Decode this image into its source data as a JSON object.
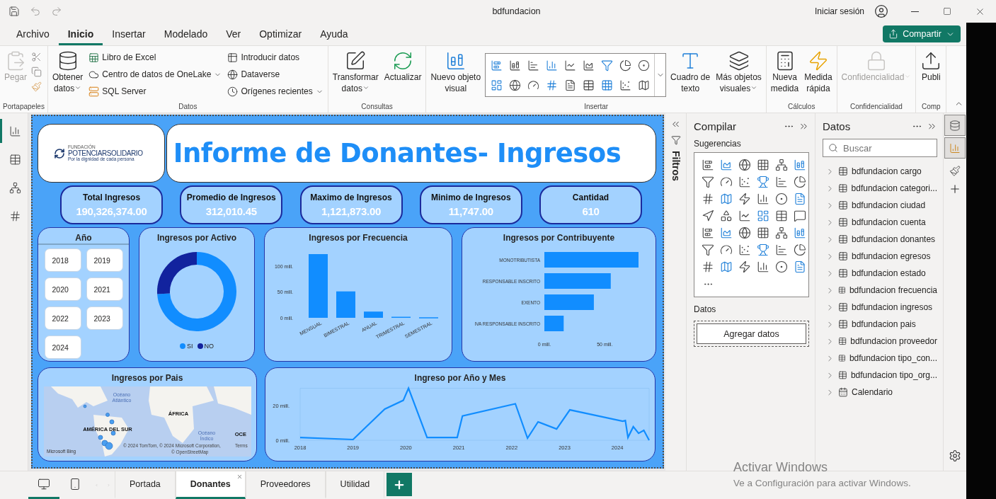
{
  "window": {
    "title": "bdfundacion",
    "sign_in": "Iniciar sesión"
  },
  "menu": [
    {
      "label": "Archivo",
      "selected": false
    },
    {
      "label": "Inicio",
      "selected": true
    },
    {
      "label": "Insertar",
      "selected": false
    },
    {
      "label": "Modelado",
      "selected": false
    },
    {
      "label": "Ver",
      "selected": false
    },
    {
      "label": "Optimizar",
      "selected": false
    },
    {
      "label": "Ayuda",
      "selected": false
    }
  ],
  "share_button": {
    "label": "Compartir"
  },
  "ribbon": [
    {
      "name": "Portapapeles",
      "items": [
        {
          "kind": "large",
          "lines": [
            "Pegar"
          ],
          "caret": false,
          "disabled": true
        },
        {
          "kind": "tools"
        }
      ]
    },
    {
      "name": "Datos",
      "items": [
        {
          "kind": "large",
          "lines": [
            "Obtener",
            "datos"
          ],
          "caret": true,
          "disabled": false
        },
        {
          "kind": "stack",
          "entries": [
            {
              "label": "Libro de Excel",
              "caret": false
            },
            {
              "label": "Centro de datos de OneLake",
              "caret": true
            },
            {
              "label": "SQL Server",
              "caret": false
            }
          ]
        },
        {
          "kind": "stack",
          "entries": [
            {
              "label": "Introducir datos",
              "caret": false
            },
            {
              "label": "Dataverse",
              "caret": false
            },
            {
              "label": "Orígenes recientes",
              "caret": true
            }
          ]
        }
      ]
    },
    {
      "name": "Consultas",
      "items": [
        {
          "kind": "large",
          "lines": [
            "Transformar",
            "datos"
          ],
          "caret": true,
          "disabled": false
        },
        {
          "kind": "large",
          "lines": [
            "Actualizar"
          ],
          "caret": false,
          "disabled": false
        }
      ]
    },
    {
      "name": "Insertar",
      "items": [
        {
          "kind": "large",
          "lines": [
            "Nuevo objeto",
            "visual"
          ],
          "caret": false,
          "disabled": false
        },
        {
          "kind": "gallery"
        },
        {
          "kind": "large",
          "lines": [
            "Cuadro de",
            "texto"
          ],
          "caret": false,
          "disabled": false
        },
        {
          "kind": "large",
          "lines": [
            "Más objetos",
            "visuales"
          ],
          "caret": true,
          "disabled": false
        }
      ]
    },
    {
      "name": "Cálculos",
      "items": [
        {
          "kind": "large",
          "lines": [
            "Nueva",
            "medida"
          ],
          "caret": false,
          "disabled": false
        },
        {
          "kind": "large",
          "lines": [
            "Medida",
            "rápida"
          ],
          "caret": false,
          "disabled": false
        }
      ]
    },
    {
      "name": "Confidencialidad",
      "items": [
        {
          "kind": "large",
          "lines": [
            "Confidencialidad"
          ],
          "caret": true,
          "disabled": true
        }
      ]
    },
    {
      "name": "Comp",
      "items": [
        {
          "kind": "large",
          "lines": [
            "Publi"
          ],
          "caret": false,
          "disabled": false
        }
      ]
    }
  ],
  "view_nav": [
    {
      "selected": true
    },
    {
      "selected": false
    },
    {
      "selected": false
    },
    {
      "selected": false
    }
  ],
  "report": {
    "logo": {
      "overline": "FUNDACIÓN",
      "name": "POTENCIARSOLIDARIO",
      "tagline": "Por la dignidad de cada persona"
    },
    "title": "Informe de Donantes- Ingresos",
    "kpis": [
      {
        "label": "Total Ingresos",
        "value": "190,326,374.00"
      },
      {
        "label": "Promedio de Ingresos",
        "value": "312,010.45"
      },
      {
        "label": "Maximo de Ingresos",
        "value": "1,121,873.00"
      },
      {
        "label": "Minimo de Ingresos",
        "value": "11,747.00"
      },
      {
        "label": "Cantidad",
        "value": "610"
      }
    ],
    "year_slicer": {
      "title": "Año",
      "years": [
        "2018",
        "2019",
        "2020",
        "2021",
        "2022",
        "2023",
        "2024"
      ]
    },
    "activo": {
      "title": "Ingresos por Activo",
      "legend": [
        {
          "color": "#118dff"
        },
        {
          "color": "#12239e"
        }
      ],
      "chart_data": {
        "type": "donut",
        "categories": [
          "SI",
          "NO"
        ],
        "values": [
          74,
          26
        ]
      }
    },
    "frecuencia": {
      "title": "Ingresos por Frecuencia",
      "chart_data": {
        "type": "bar",
        "categories": [
          "MENSUAL",
          "BIMESTRAL",
          "ANUAL",
          "TRIMESTRAL",
          "SEMESTRAL"
        ],
        "values": [
          123,
          51,
          12,
          2,
          1
        ],
        "ylim": [
          0,
          123
        ],
        "yticks": [
          {
            "value": 0,
            "label": "0 mill."
          },
          {
            "value": 50,
            "label": "50 mill."
          },
          {
            "value": 100,
            "label": "100 mill."
          }
        ]
      }
    },
    "contribuyente": {
      "title": "Ingresos por Contribuyente",
      "chart_data": {
        "type": "bar",
        "orientation": "horizontal",
        "categories": [
          "MONOTRIBUTISTA",
          "RESPONSABLE INSCRITO",
          "EXENTO",
          "IVA RESPONSABLE INSCRITO"
        ],
        "values": [
          78,
          55,
          41,
          16
        ],
        "xlim": [
          0,
          78
        ],
        "xticks": [
          {
            "value": 0,
            "label": "0 mill."
          },
          {
            "value": 50,
            "label": "50 mill."
          }
        ]
      }
    },
    "pais": {
      "title": "Ingresos por Pais",
      "labels": [
        "Océano",
        "Atlántico",
        "ÁFRICA",
        "AMÉRICA DEL SUR",
        "Océano",
        "Índico",
        "OCE"
      ],
      "attribution": "Microsoft Bing",
      "copyright": "© 2024 TomTom, © 2024 Microsoft Corporation,",
      "terms": "Terms",
      "osm": "© OpenStreetMap"
    },
    "linea": {
      "title": "Ingreso por Año y Mes",
      "chart_data": {
        "type": "line",
        "x": [
          2018.0,
          2019.0,
          2019.6,
          2019.95,
          2020.05,
          2020.4,
          2020.97,
          2021.07,
          2022.07,
          2022.3,
          2022.5,
          2022.85,
          2023.1,
          2024.1,
          2024.15,
          2024.2,
          2024.3,
          2024.4,
          2024.5,
          2024.6
        ],
        "values": [
          1.6,
          0.4,
          18,
          23,
          30,
          1.6,
          1.6,
          14,
          21,
          1.2,
          10.6,
          6.5,
          17.5,
          11,
          11.4,
          1.6,
          7.8,
          4,
          5.7,
          0
        ],
        "xlim": [
          2018,
          2024.6
        ],
        "ylim": [
          0,
          30
        ],
        "xticks": [
          2018,
          2019,
          2020,
          2021,
          2022,
          2023,
          2024
        ],
        "yticks": [
          {
            "value": 0,
            "label": "0 mill."
          },
          {
            "value": 20,
            "label": "20 mill."
          }
        ]
      }
    }
  },
  "filters": {
    "label": "Filtros"
  },
  "build_pane": {
    "title": "Compilar",
    "suggestions": "Sugerencias",
    "data_label": "Datos",
    "add_button": "Agregar datos"
  },
  "data_pane": {
    "title": "Datos",
    "search_placeholder": "Buscar",
    "tables": [
      {
        "label": "bdfundacion cargo",
        "kind": "table",
        "expanded": false
      },
      {
        "label": "bdfundacion categori...",
        "kind": "table",
        "expanded": false
      },
      {
        "label": "bdfundacion ciudad",
        "kind": "table",
        "expanded": false
      },
      {
        "label": "bdfundacion cuenta",
        "kind": "table",
        "expanded": false
      },
      {
        "label": "bdfundacion donantes",
        "kind": "table",
        "expanded": false
      },
      {
        "label": "bdfundacion egresos",
        "kind": "table",
        "expanded": false
      },
      {
        "label": "bdfundacion estado",
        "kind": "table",
        "expanded": false
      },
      {
        "label": "bdfundacion frecuencia",
        "kind": "table",
        "expanded": false
      },
      {
        "label": "bdfundacion ingresos",
        "kind": "table",
        "expanded": false
      },
      {
        "label": "bdfundacion pais",
        "kind": "table",
        "expanded": false
      },
      {
        "label": "bdfundacion proveedor",
        "kind": "table",
        "expanded": false
      },
      {
        "label": "bdfundacion tipo_con...",
        "kind": "table",
        "expanded": false
      },
      {
        "label": "bdfundacion tipo_org...",
        "kind": "table",
        "expanded": false
      },
      {
        "label": "Calendario",
        "kind": "calendar",
        "expanded": false
      }
    ]
  },
  "pane_switcher": [
    {
      "selected": true
    },
    {
      "selected": true
    },
    {
      "selected": false
    }
  ],
  "page_views": [
    {
      "selected": true
    },
    {
      "selected": false
    }
  ],
  "page_tabs": [
    {
      "label": "Portada",
      "selected": false
    },
    {
      "label": "Donantes",
      "selected": true
    },
    {
      "label": "Proveedores",
      "selected": false
    },
    {
      "label": "Utilidad",
      "selected": false
    }
  ],
  "activation": {
    "title": "Activar Windows",
    "text": "Ve a Configuración para activar Windows."
  }
}
